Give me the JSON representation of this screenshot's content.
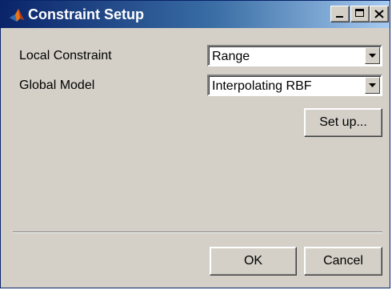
{
  "window": {
    "title": "Constraint Setup",
    "controls": {
      "minimize_icon": "minimize-icon",
      "maximize_icon": "maximize-icon",
      "close_icon": "close-icon"
    }
  },
  "form": {
    "local_constraint": {
      "label": "Local Constraint",
      "value": "Range"
    },
    "global_model": {
      "label": "Global Model",
      "value": "Interpolating RBF"
    },
    "setup_button": "Set up..."
  },
  "footer": {
    "ok": "OK",
    "cancel": "Cancel"
  },
  "colors": {
    "title_start": "#0a246a",
    "title_end": "#a6caf0",
    "face": "#d4d0c8"
  }
}
